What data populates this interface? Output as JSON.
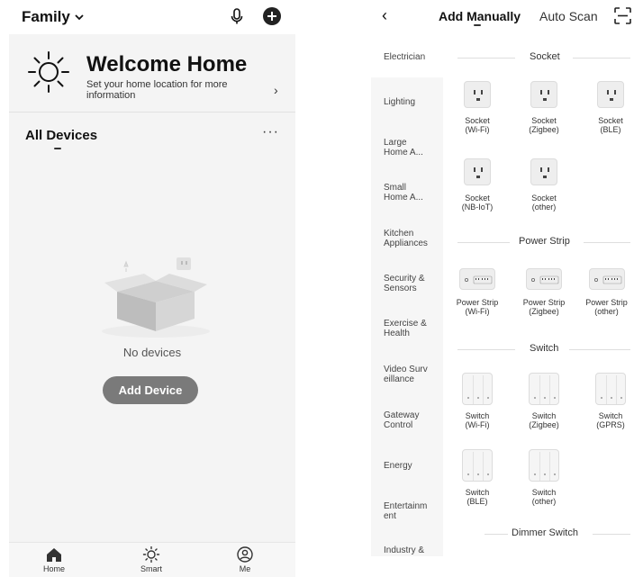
{
  "home": {
    "family_label": "Family",
    "welcome_title": "Welcome Home",
    "welcome_subtitle": "Set your home location for more information",
    "section_title": "All Devices",
    "more_label": "···",
    "empty_text": "No devices",
    "add_device_label": "Add Device",
    "tabs": [
      {
        "label": "Home",
        "icon": "home-icon"
      },
      {
        "label": "Smart",
        "icon": "sun-icon"
      },
      {
        "label": "Me",
        "icon": "user-icon"
      }
    ]
  },
  "add": {
    "tabs": {
      "manual": "Add Manually",
      "scan": "Auto Scan"
    },
    "categories": [
      "Electrician",
      "Lighting",
      "Large Home A...",
      "Small Home A...",
      "Kitchen Appliances",
      "Security & Sensors",
      "Exercise & Health",
      "Video Surv eillance",
      "Gateway Control",
      "Energy",
      "Entertainm ent",
      "Industry &"
    ],
    "sections": {
      "socket": {
        "title": "Socket",
        "items": [
          {
            "name": "Socket",
            "sub": "(Wi-Fi)"
          },
          {
            "name": "Socket",
            "sub": "(Zigbee)"
          },
          {
            "name": "Socket",
            "sub": "(BLE)"
          },
          {
            "name": "Socket",
            "sub": "(NB-IoT)"
          },
          {
            "name": "Socket",
            "sub": "(other)"
          }
        ]
      },
      "power_strip": {
        "title": "Power Strip",
        "items": [
          {
            "name": "Power Strip",
            "sub": "(Wi-Fi)"
          },
          {
            "name": "Power Strip",
            "sub": "(Zigbee)"
          },
          {
            "name": "Power Strip",
            "sub": "(other)"
          }
        ]
      },
      "switch": {
        "title": "Switch",
        "items": [
          {
            "name": "Switch",
            "sub": "(Wi-Fi)"
          },
          {
            "name": "Switch",
            "sub": "(Zigbee)"
          },
          {
            "name": "Switch",
            "sub": "(GPRS)"
          },
          {
            "name": "Switch",
            "sub": "(BLE)"
          },
          {
            "name": "Switch",
            "sub": "(other)"
          }
        ]
      },
      "dimmer": {
        "title": "Dimmer Switch"
      }
    }
  }
}
